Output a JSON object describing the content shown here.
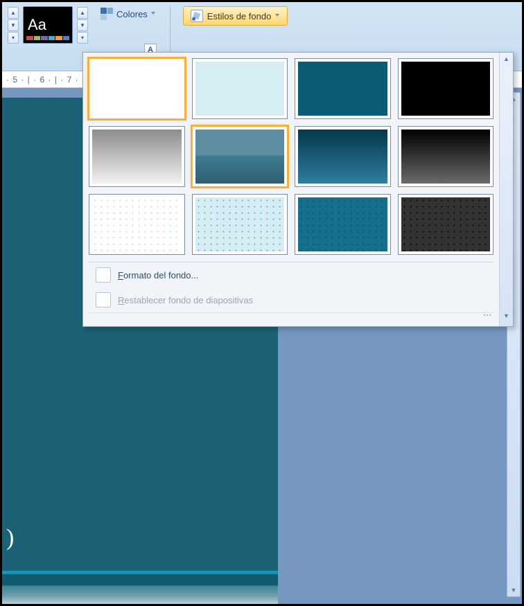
{
  "ribbon": {
    "theme_sample_text": "Aa",
    "colors_label": "Colores",
    "background_styles_label": "Estilos de fondo"
  },
  "ruler": {
    "text": "· 5 · | · 6 · | · 7 · | ·"
  },
  "popup": {
    "styles": [
      {
        "name": "style-1-white-solid"
      },
      {
        "name": "style-2-light-blue-solid"
      },
      {
        "name": "style-3-teal-solid"
      },
      {
        "name": "style-4-black-solid"
      },
      {
        "name": "style-5-gray-gradient"
      },
      {
        "name": "style-6-blue-gradient",
        "selected": true
      },
      {
        "name": "style-7-dark-teal-gradient"
      },
      {
        "name": "style-8-black-gradient"
      },
      {
        "name": "style-9-white-dotted"
      },
      {
        "name": "style-10-light-blue-dotted"
      },
      {
        "name": "style-11-teal-dotted"
      },
      {
        "name": "style-12-dark-dotted"
      }
    ],
    "menu": {
      "format_background": "Formato del fondo...",
      "reset_background": "Restablecer fondo de diapositivas"
    }
  },
  "slide": {
    "placeholder_fragment": ")"
  }
}
